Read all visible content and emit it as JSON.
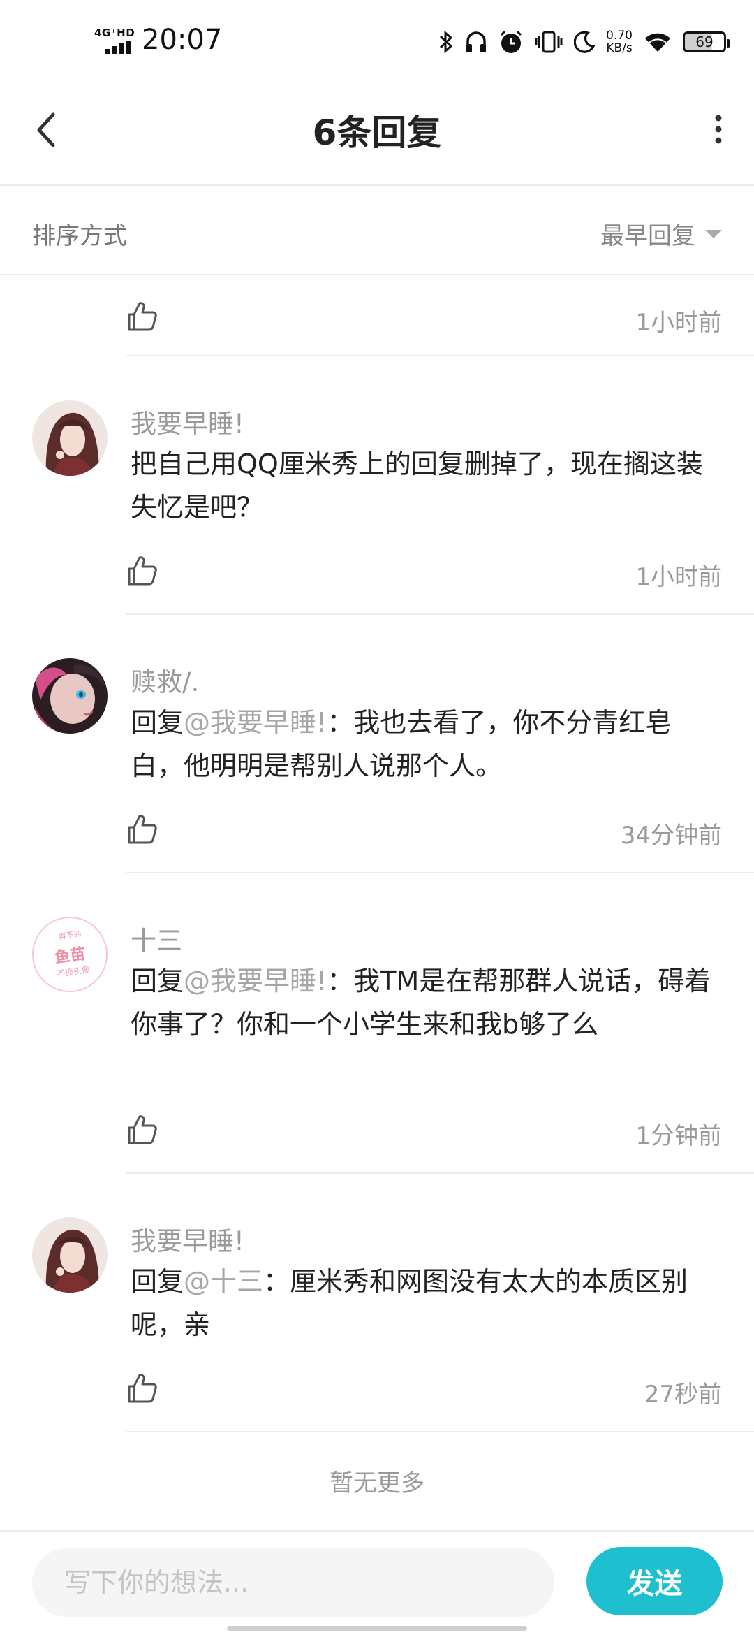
{
  "status_bar": {
    "network": "4G⁺HD",
    "time": "20:07",
    "speed_value": "0.70",
    "speed_unit": "KB/s",
    "battery": "69"
  },
  "header": {
    "title": "6条回复"
  },
  "sort": {
    "label": "排序方式",
    "value": "最早回复"
  },
  "first_item": {
    "time": "1小时前"
  },
  "replies": [
    {
      "username": "我要早睡!",
      "prefix": "",
      "mention": "",
      "text": "把自己用QQ厘米秀上的回复删掉了，现在搁这装失忆是吧？",
      "time": "1小时前"
    },
    {
      "username": "赎救/.",
      "prefix": "回复",
      "mention": "@我要早睡!",
      "text": "：我也去看了，你不分青红皂白，他明明是帮别人说那个人。",
      "time": "34分钟前"
    },
    {
      "username": "十三",
      "prefix": "回复",
      "mention": "@我要早睡!",
      "text": "：我TM是在帮那群人说话，碍着你事了？你和一个小学生来和我b够了么",
      "time": "1分钟前",
      "avatar_text": [
        "再不到",
        "鱼苗",
        "不换头像"
      ]
    },
    {
      "username": "我要早睡!",
      "prefix": "回复",
      "mention": "@十三",
      "text": "：厘米秀和网图没有太大的本质区别呢，亲",
      "time": "27秒前"
    }
  ],
  "no_more": "暂无更多",
  "composer": {
    "placeholder": "写下你的想法...",
    "send_label": "发送"
  },
  "colors": {
    "accent": "#1fbfcf",
    "mention": "#a6a6a6",
    "meta_text": "#9a9a9a",
    "divider": "#ececec"
  }
}
